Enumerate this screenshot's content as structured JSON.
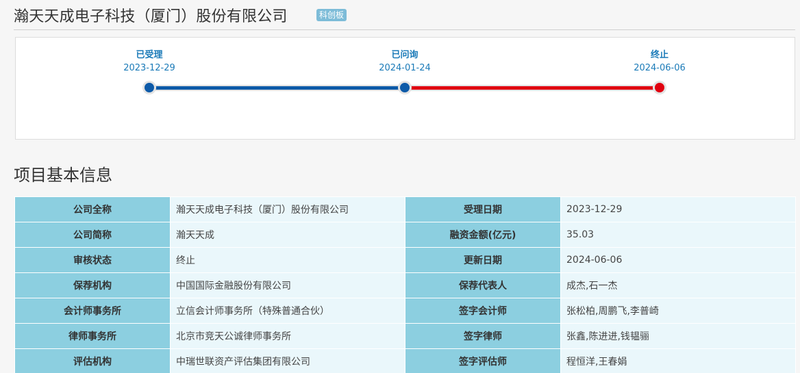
{
  "header": {
    "company_name": "瀚天天成电子科技（厦门）股份有限公司",
    "board_badge": "科创板"
  },
  "timeline": {
    "steps": [
      {
        "label": "已受理",
        "date": "2023-12-29"
      },
      {
        "label": "已问询",
        "date": "2024-01-24"
      },
      {
        "label": "终止",
        "date": "2024-06-06"
      }
    ],
    "colors": {
      "done": "#0d5aa8",
      "terminated": "#e00010",
      "track": "#e2e2e2"
    }
  },
  "section": {
    "title": "项目基本信息"
  },
  "info_table": {
    "rows": [
      {
        "k1": "公司全称",
        "v1": "瀚天天成电子科技（厦门）股份有限公司",
        "k2": "受理日期",
        "v2": "2023-12-29"
      },
      {
        "k1": "公司简称",
        "v1": "瀚天天成",
        "k2": "融资金额(亿元)",
        "v2": "35.03"
      },
      {
        "k1": "审核状态",
        "v1": "终止",
        "k2": "更新日期",
        "v2": "2024-06-06"
      },
      {
        "k1": "保荐机构",
        "v1": "中国国际金融股份有限公司",
        "k2": "保荐代表人",
        "v2": "成杰,石一杰"
      },
      {
        "k1": "会计师事务所",
        "v1": "立信会计师事务所（特殊普通合伙）",
        "k2": "签字会计师",
        "v2": "张松柏,周鹏飞,李普崎"
      },
      {
        "k1": "律师事务所",
        "v1": "北京市竞天公诚律师事务所",
        "k2": "签字律师",
        "v2": "张鑫,陈进进,钱韫骊"
      },
      {
        "k1": "评估机构",
        "v1": "中瑞世联资产评估集团有限公司",
        "k2": "签字评估师",
        "v2": "程恒洋,王春娟"
      }
    ],
    "colors": {
      "key_bg": "#8ccfe0",
      "value_bg": "#eaf7fb"
    }
  }
}
